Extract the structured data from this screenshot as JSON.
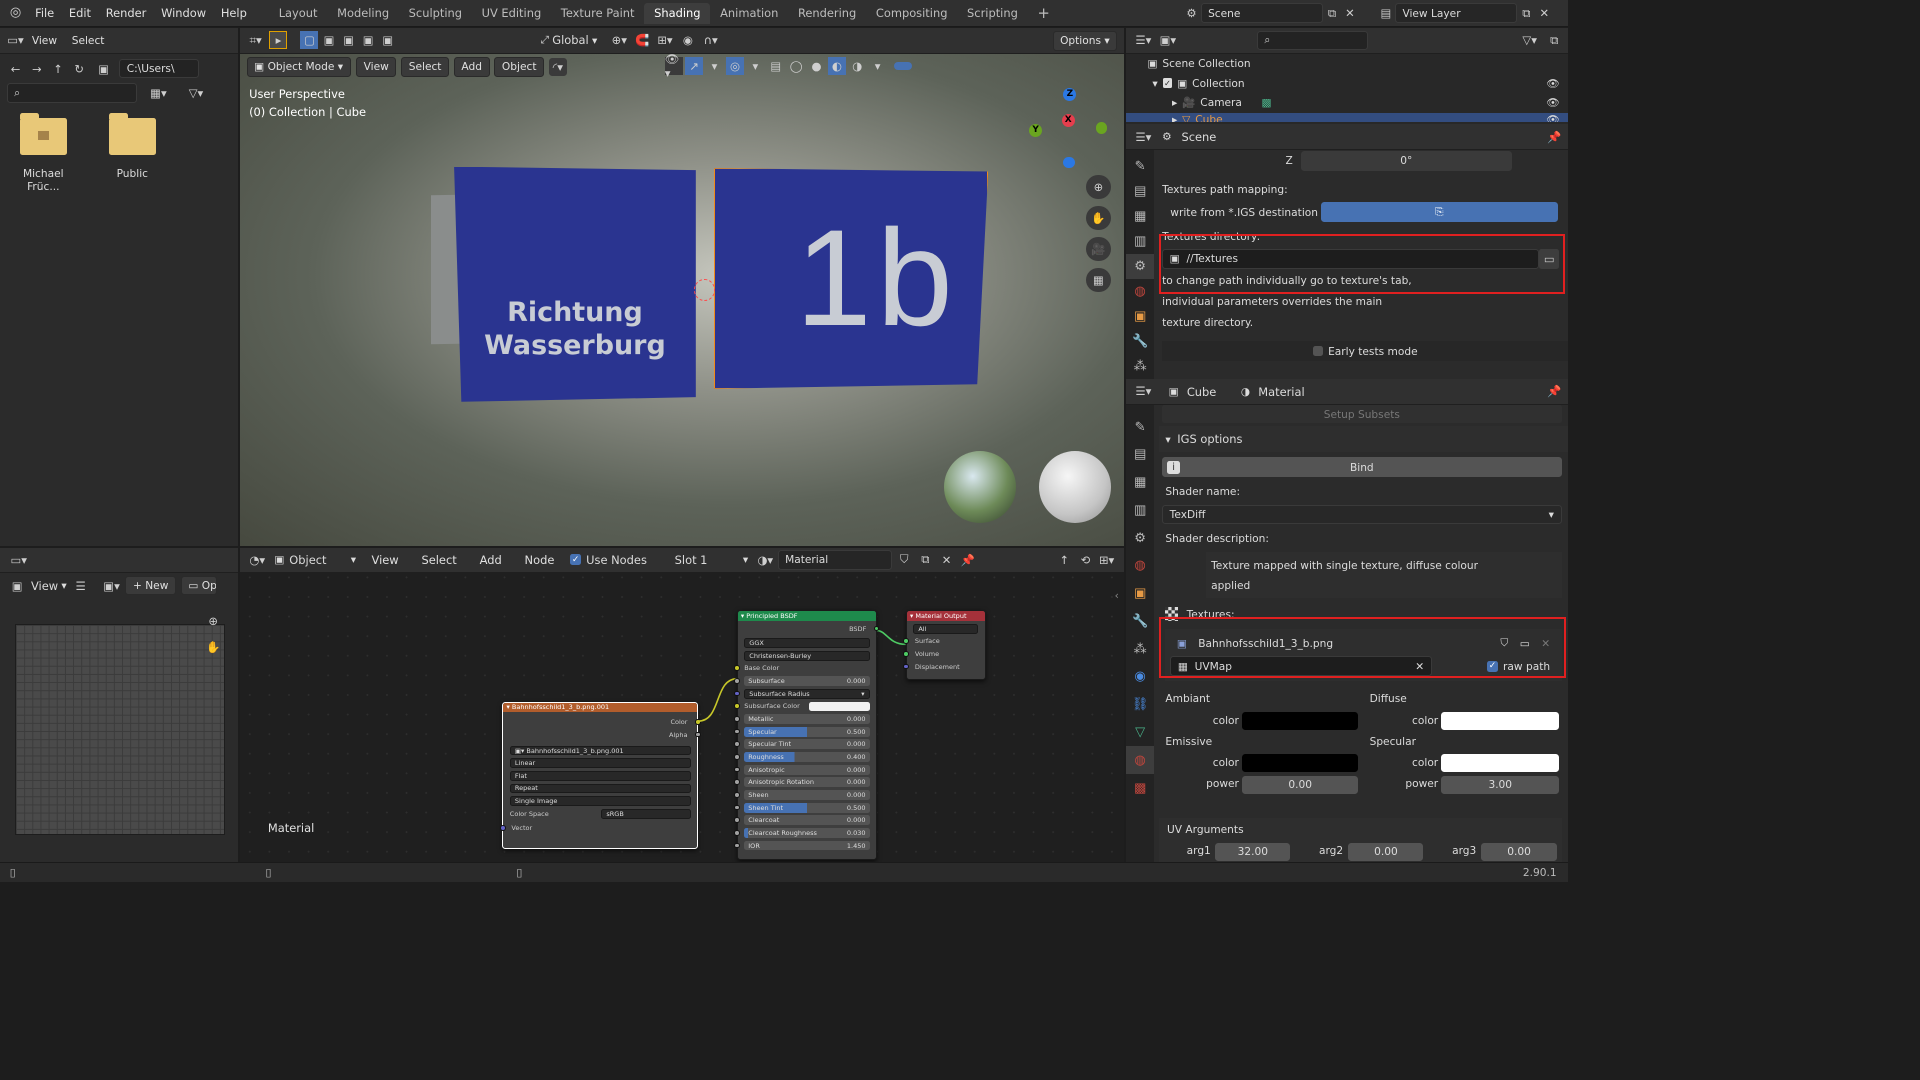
{
  "topbar": {
    "menus": [
      "File",
      "Edit",
      "Render",
      "Window",
      "Help"
    ],
    "workspaces": [
      {
        "label": "Layout",
        "active": false
      },
      {
        "label": "Modeling",
        "active": false
      },
      {
        "label": "Sculpting",
        "active": false
      },
      {
        "label": "UV Editing",
        "active": false
      },
      {
        "label": "Texture Paint",
        "active": false
      },
      {
        "label": "Shading",
        "active": true
      },
      {
        "label": "Animation",
        "active": false
      },
      {
        "label": "Rendering",
        "active": false
      },
      {
        "label": "Compositing",
        "active": false
      },
      {
        "label": "Scripting",
        "active": false
      }
    ],
    "add_workspace": "+",
    "scene": "Scene",
    "view_layer": "View Layer"
  },
  "file_browser": {
    "menus": [
      "View",
      "Select"
    ],
    "path": "C:\\Users\\",
    "items": [
      {
        "label": "Michael Früc...",
        "icon": "home-folder-icon"
      },
      {
        "label": "Public",
        "icon": "folder-icon"
      }
    ]
  },
  "viewport": {
    "mode": "Object Mode",
    "menus": [
      "View",
      "Select",
      "Add",
      "Object"
    ],
    "transform_orientation": "Global",
    "options": "Options",
    "overlay_title": "User Perspective",
    "overlay_subtitle": "(0) Collection | Cube",
    "sign_left_line1": "Richtung",
    "sign_left_line2": "Wasserburg",
    "sign_right": "1b",
    "gizmo": {
      "x": "X",
      "y": "Y",
      "z": "Z"
    }
  },
  "image_editor": {
    "view_menu": "View",
    "new_button": "New",
    "open_button": "Op"
  },
  "node_editor": {
    "object_type": "Object",
    "menus": [
      "View",
      "Select",
      "Add",
      "Node"
    ],
    "use_nodes_label": "Use Nodes",
    "slot": "Slot 1",
    "material": "Material",
    "footer_label": "Material",
    "image_node": {
      "title": "Bahnhofsschild1_3_b.png.001",
      "outputs": [
        "Color",
        "Alpha"
      ],
      "image": "Bahnhofsschild1_3_b.png.001",
      "interpolation": "Linear",
      "projection": "Flat",
      "extension": "Repeat",
      "source": "Single Image",
      "color_space_label": "Color Space",
      "color_space": "sRGB",
      "input": "Vector"
    },
    "bsdf_node": {
      "title": "Principled BSDF",
      "output": "BSDF",
      "distribution": "GGX",
      "subsurface_method": "Christensen-Burley",
      "inputs": [
        {
          "label": "Base Color",
          "value": "",
          "kind": "label"
        },
        {
          "label": "Subsurface",
          "value": "0.000",
          "kind": "num",
          "fill": 0
        },
        {
          "label": "Subsurface Radius",
          "value": "",
          "kind": "dd"
        },
        {
          "label": "Subsurface Color",
          "value": "",
          "kind": "color"
        },
        {
          "label": "Metallic",
          "value": "0.000",
          "kind": "num",
          "fill": 0
        },
        {
          "label": "Specular",
          "value": "0.500",
          "kind": "num",
          "fill": 50
        },
        {
          "label": "Specular Tint",
          "value": "0.000",
          "kind": "num",
          "fill": 0
        },
        {
          "label": "Roughness",
          "value": "0.400",
          "kind": "num",
          "fill": 40
        },
        {
          "label": "Anisotropic",
          "value": "0.000",
          "kind": "num",
          "fill": 0
        },
        {
          "label": "Anisotropic Rotation",
          "value": "0.000",
          "kind": "num",
          "fill": 0
        },
        {
          "label": "Sheen",
          "value": "0.000",
          "kind": "num",
          "fill": 0
        },
        {
          "label": "Sheen Tint",
          "value": "0.500",
          "kind": "num",
          "fill": 50
        },
        {
          "label": "Clearcoat",
          "value": "0.000",
          "kind": "num",
          "fill": 0
        },
        {
          "label": "Clearcoat Roughness",
          "value": "0.030",
          "kind": "num",
          "fill": 3
        },
        {
          "label": "IOR",
          "value": "1.450",
          "kind": "num",
          "fill": 0
        }
      ]
    },
    "output_node": {
      "title": "Material Output",
      "target": "All",
      "inputs": [
        "Surface",
        "Volume",
        "Displacement"
      ]
    }
  },
  "outliner": {
    "scene_collection": "Scene Collection",
    "collection": "Collection",
    "camera": "Camera",
    "cube": "Cube"
  },
  "scene_props": {
    "header": "Scene",
    "z_label": "Z",
    "z_value": "0°",
    "textures_path_mapping": "Textures path mapping:",
    "write_from_label": "write from *.IGS destination",
    "textures_directory_label": "Textures directory:",
    "textures_directory": "//Textures",
    "note_line1": "to change path individually go to texture's tab,",
    "note_line2": "individual parameters overrides the main",
    "note_line3": "texture directory.",
    "early_tests": "Early tests mode"
  },
  "material_props": {
    "object": "Cube",
    "material": "Material",
    "setup_subsets": "Setup Subsets",
    "igs_options": "IGS options",
    "bind": "Bind",
    "shader_name_label": "Shader name:",
    "shader_name": "TexDiff",
    "shader_desc_label": "Shader description:",
    "shader_desc_line1": "Texture mapped with single texture, diffuse colour",
    "shader_desc_line2": "applied",
    "textures_label": "Textures:",
    "texture_file": "Bahnhofsschild1_3_b.png",
    "uvmap": "UVMap",
    "raw_path": "raw path",
    "ambient": "Ambiant",
    "diffuse": "Diffuse",
    "emissive": "Emissive",
    "specular": "Specular",
    "color_label": "color",
    "power_label": "power",
    "emissive_power": "0.00",
    "specular_power": "3.00",
    "uv_arguments": "UV Arguments",
    "arg1_label": "arg1",
    "arg1": "32.00",
    "arg2_label": "arg2",
    "arg2": "0.00",
    "arg3_label": "arg3",
    "arg3": "0.00",
    "colors": {
      "ambient": "#000000",
      "diffuse": "#ffffff",
      "emissive": "#000000",
      "specular": "#ffffff"
    }
  },
  "status": {
    "version": "2.90.1"
  }
}
